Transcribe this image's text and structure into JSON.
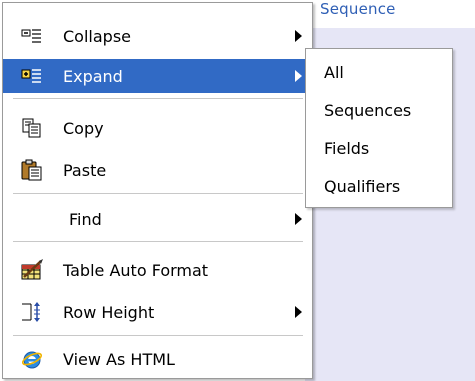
{
  "background": {
    "header_text": "Sequence"
  },
  "context_menu": {
    "items": [
      {
        "label": "Collapse",
        "icon": "collapse-icon",
        "has_submenu": true
      },
      {
        "label": "Expand",
        "icon": "expand-icon",
        "has_submenu": true,
        "highlighted": true
      },
      {
        "label": "Copy",
        "icon": "copy-icon"
      },
      {
        "label": "Paste",
        "icon": "paste-icon"
      },
      {
        "label": "Find",
        "icon": "",
        "has_submenu": true
      },
      {
        "label": "Table Auto Format",
        "icon": "table-auto-format-icon"
      },
      {
        "label": "Row Height",
        "icon": "row-height-icon",
        "has_submenu": true
      },
      {
        "label": "View As HTML",
        "icon": "internet-explorer-icon"
      }
    ]
  },
  "expand_submenu": {
    "items": [
      {
        "label": "All"
      },
      {
        "label": "Sequences"
      },
      {
        "label": "Fields"
      },
      {
        "label": "Qualifiers"
      }
    ]
  },
  "colors": {
    "highlight": "#316ac5",
    "menu_border": "#9a9a9a",
    "background_panel": "#e6e6f6"
  }
}
